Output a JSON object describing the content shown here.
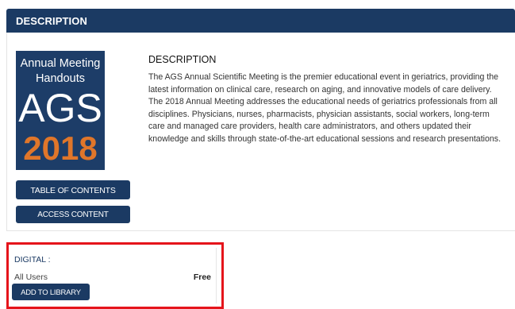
{
  "header": {
    "title": "DESCRIPTION"
  },
  "cover": {
    "line1": "Annual Meeting",
    "line2": "Handouts",
    "org": "AGS",
    "year": "2018",
    "colors": {
      "background": "#1d3d68",
      "year": "#e0762a"
    }
  },
  "buttons": {
    "table_of_contents": "TABLE OF CONTENTS",
    "access_content": "ACCESS CONTENT",
    "add_to_library": "ADD TO LIBRARY"
  },
  "description": {
    "title": "DESCRIPTION",
    "body": "The AGS Annual Scientific Meeting is the premier educational event in geriatrics, providing the latest information on clinical care, research on aging, and innovative models of care delivery. The 2018 Annual Meeting addresses the educational needs of geriatrics professionals from all disciplines. Physicians, nurses, pharmacists, physician assistants, social workers, long-term care and managed care providers, health care administrators, and others updated their knowledge and skills through state-of-the-art educational sessions and research presentations."
  },
  "digital": {
    "label": "DIGITAL :",
    "audience": "All Users",
    "price": "Free"
  },
  "colors": {
    "brand_navy": "#1b3a63",
    "highlight_red": "#e5141b"
  }
}
